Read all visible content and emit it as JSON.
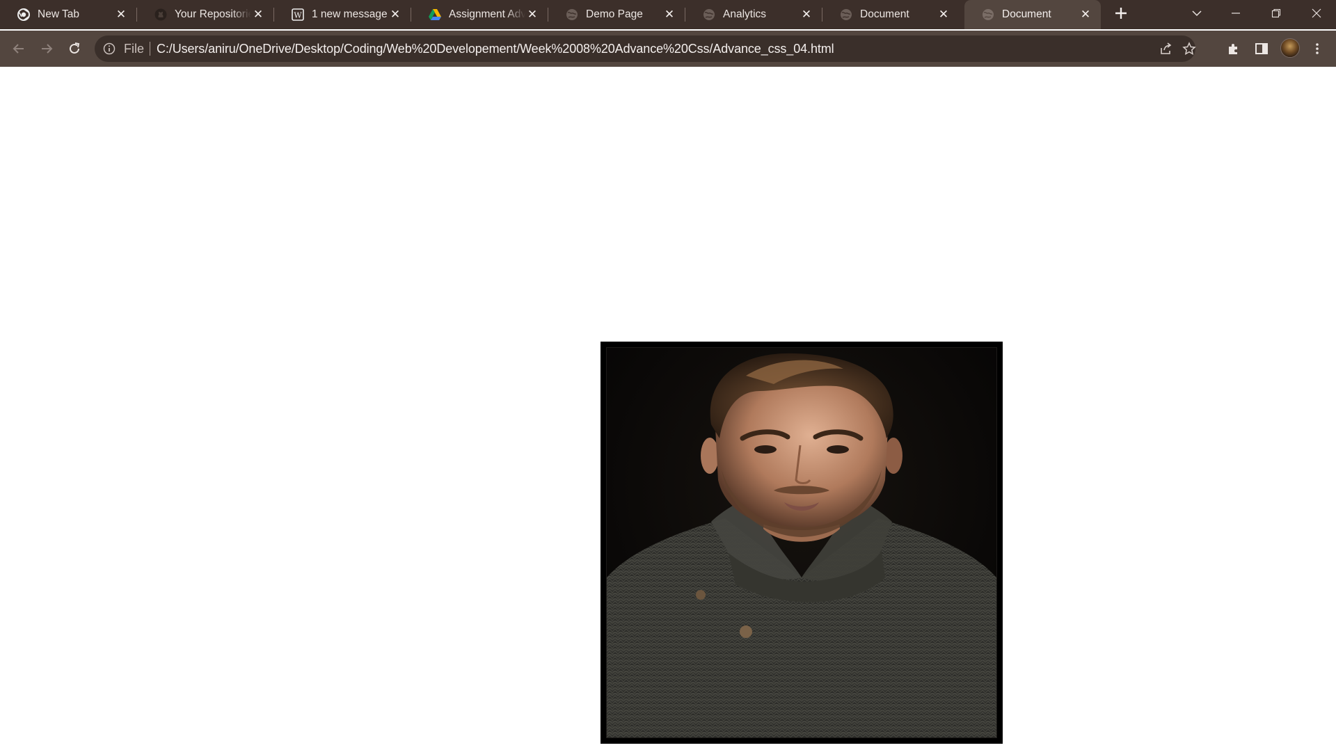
{
  "browser": {
    "tabs": [
      {
        "title": "New Tab",
        "icon": "chrome-icon",
        "active": false
      },
      {
        "title": "Your Repositories",
        "icon": "github-icon",
        "active": false
      },
      {
        "title": "1 new message",
        "icon": "wordpress-icon",
        "active": false
      },
      {
        "title": "Assignment Adv",
        "icon": "google-drive-icon",
        "active": false
      },
      {
        "title": "Demo Page",
        "icon": "globe-icon",
        "active": false
      },
      {
        "title": "Analytics",
        "icon": "globe-icon",
        "active": false
      },
      {
        "title": "Document",
        "icon": "globe-icon",
        "active": false
      },
      {
        "title": "Document",
        "icon": "globe-icon",
        "active": true
      }
    ],
    "address_bar": {
      "scheme_label": "File",
      "url": "C:/Users/aniru/OneDrive/Desktop/Coding/Web%20Developement/Week%2008%20Advance%20Css/Advance_css_04.html"
    },
    "colors": {
      "tabstrip": "#3c2f2a",
      "toolbar": "#53463f",
      "omnibox": "#3a2f2a"
    }
  },
  "page": {
    "background": "#ffffff",
    "image": {
      "subject": "portrait photo",
      "border_color": "#000000"
    }
  }
}
